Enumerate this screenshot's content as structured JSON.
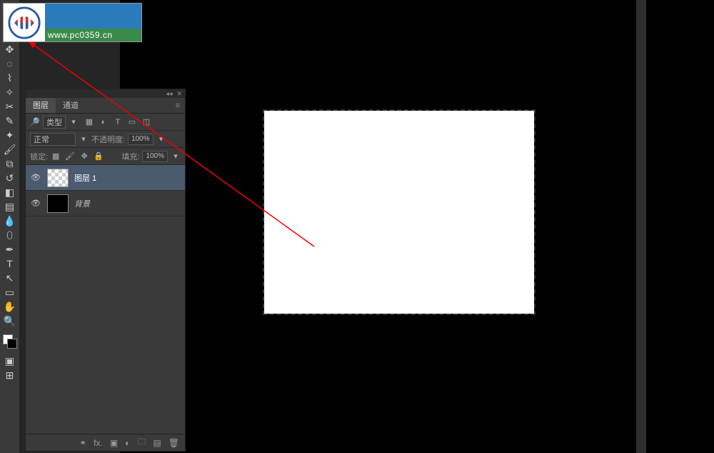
{
  "watermark": {
    "url": "www.pc0359.cn"
  },
  "panel": {
    "tabs": {
      "layers": "图层",
      "channels": "通道"
    },
    "filter": {
      "type": "类型"
    },
    "blend": {
      "mode": "正常",
      "opacity_label": "不透明度:",
      "opacity_value": "100%"
    },
    "lock": {
      "label": "锁定:",
      "fill_label": "填充:",
      "fill_value": "100%"
    }
  },
  "layers": [
    {
      "name": "图层 1",
      "visible": true,
      "thumb": "checker",
      "selected": true,
      "italic": false
    },
    {
      "name": "背景",
      "visible": true,
      "thumb": "black",
      "selected": false,
      "italic": true
    }
  ],
  "tools": [
    "move",
    "marquee",
    "lasso",
    "wand",
    "crop",
    "eyedropper",
    "heal",
    "brush",
    "stamp",
    "history",
    "eraser",
    "gradient",
    "blur",
    "dodge",
    "pen",
    "text",
    "path",
    "rect",
    "hand",
    "zoom"
  ]
}
